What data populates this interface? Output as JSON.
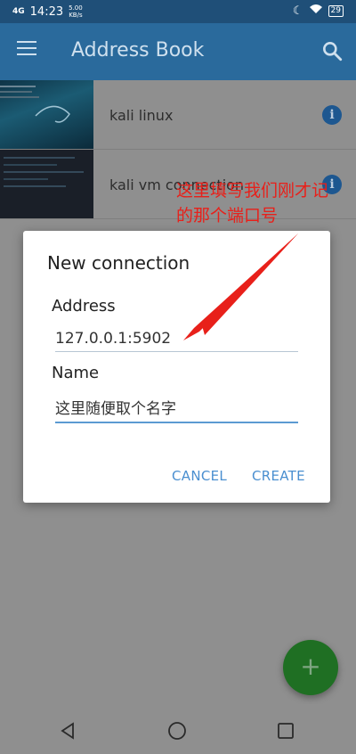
{
  "status_bar": {
    "signal": "4G",
    "time": "14:23",
    "speed_value": "5.00",
    "speed_unit": "KB/s",
    "battery": "29"
  },
  "app_bar": {
    "title": "Address Book"
  },
  "connections": [
    {
      "label": "kali linux"
    },
    {
      "label": "kali vm connection"
    }
  ],
  "annotation": {
    "line1": "这里填写我们刚才记",
    "line2": "的那个端口号"
  },
  "dialog": {
    "title": "New connection",
    "address_label": "Address",
    "address_value": "127.0.0.1:5902",
    "name_label": "Name",
    "name_value": "这里随便取个名字",
    "cancel_label": "CANCEL",
    "create_label": "CREATE"
  },
  "fab": {
    "symbol": "+"
  },
  "colors": {
    "app_bar": "#2a6a9c",
    "accent": "#4a8fd0",
    "fab": "#1f6f23",
    "annotation": "#e8201a"
  }
}
